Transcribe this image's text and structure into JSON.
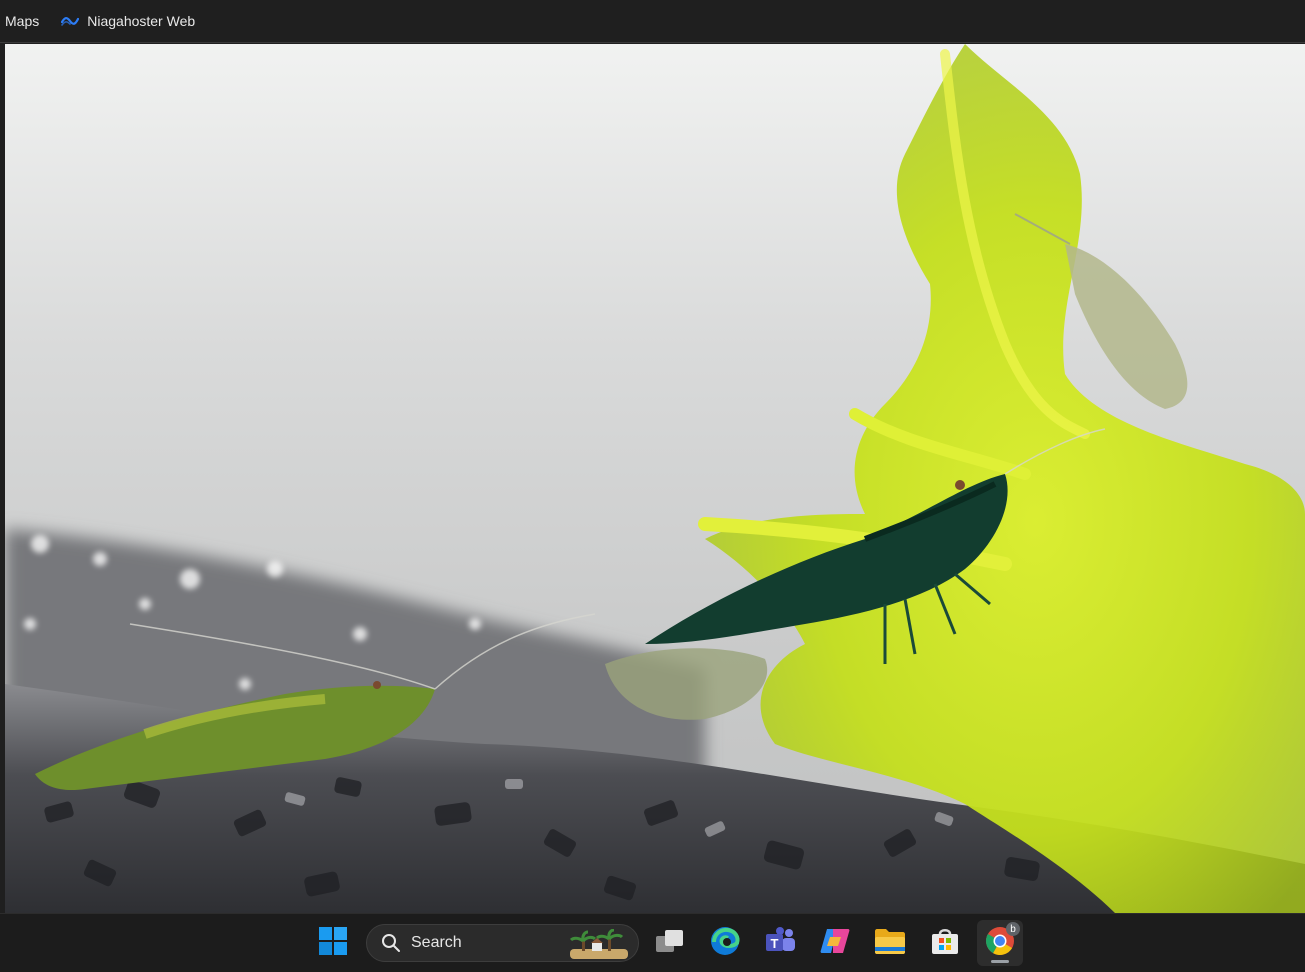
{
  "bookmarks_bar": {
    "items": [
      {
        "label": "Maps",
        "icon": "none"
      },
      {
        "label": "Niagahoster Web",
        "icon": "niagahoster-wave-icon"
      }
    ]
  },
  "content": {
    "image_subject": "photo",
    "colors": {
      "background": "#d0d1d1",
      "moss": "#c6e21a",
      "gravel": "#5c5d62"
    }
  },
  "taskbar": {
    "search": {
      "label": "Search",
      "decoration_icon": "palm-island-icon"
    },
    "items": [
      {
        "name": "start",
        "icon": "windows-logo-icon"
      },
      {
        "name": "task-view",
        "icon": "task-view-icon"
      },
      {
        "name": "edge",
        "icon": "edge-icon"
      },
      {
        "name": "teams",
        "icon": "teams-icon"
      },
      {
        "name": "copilot",
        "icon": "copilot-icon"
      },
      {
        "name": "file-explorer",
        "icon": "folder-icon"
      },
      {
        "name": "microsoft-store",
        "icon": "store-icon"
      },
      {
        "name": "chrome",
        "icon": "chrome-icon",
        "active": true,
        "badge": "b"
      }
    ],
    "colors": {
      "background": "#1c1c1c",
      "windows_blue": "#1a9bf0"
    }
  }
}
